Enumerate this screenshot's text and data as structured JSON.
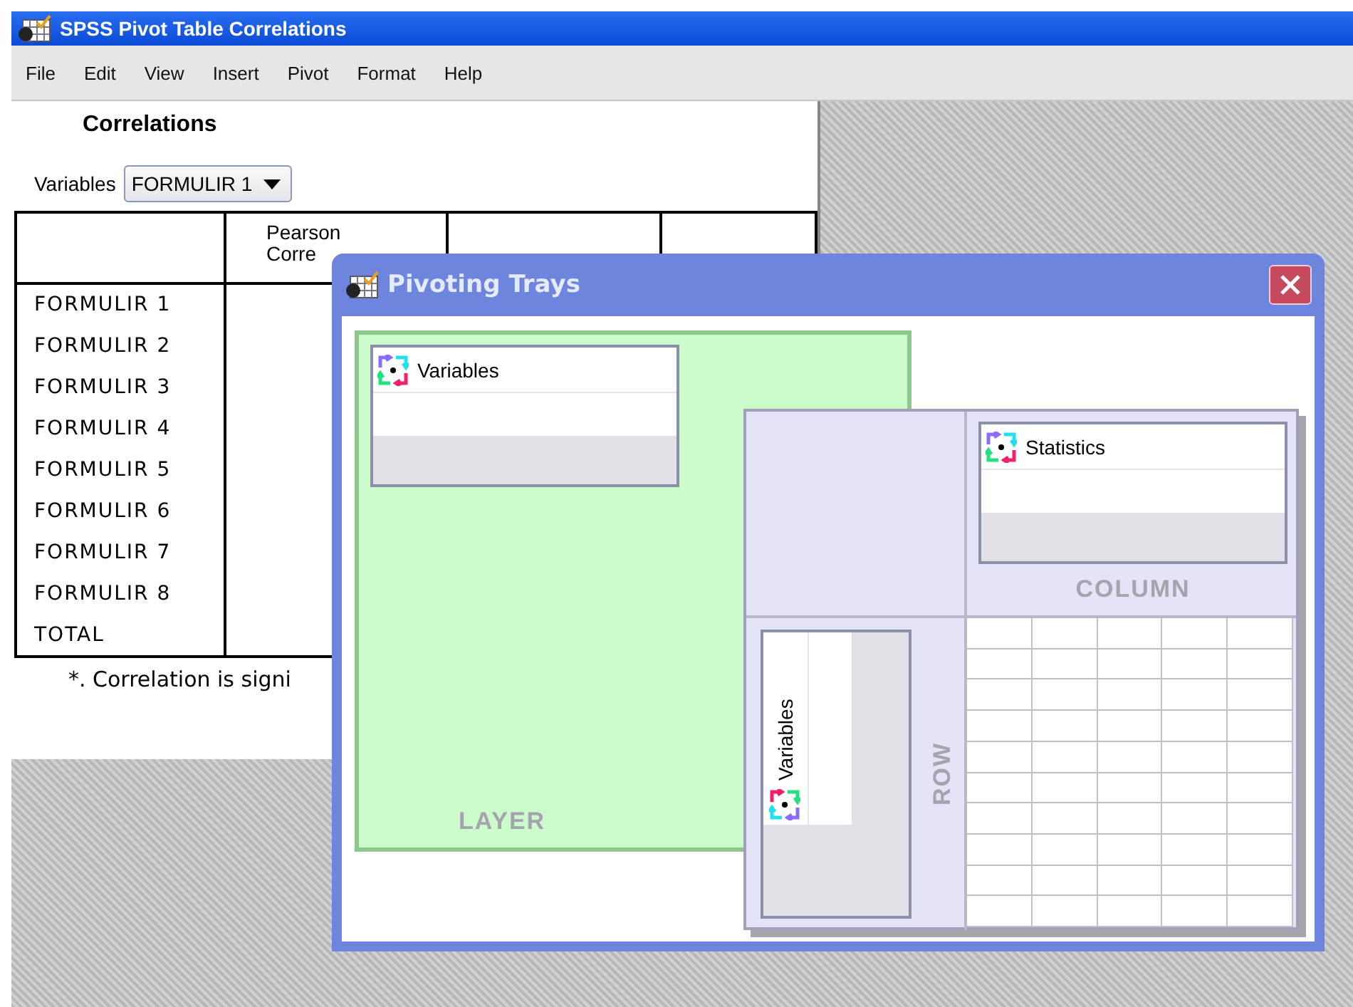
{
  "window": {
    "title": "SPSS Pivot Table Correlations"
  },
  "menu": [
    "File",
    "Edit",
    "View",
    "Insert",
    "Pivot",
    "Format",
    "Help"
  ],
  "report": {
    "title": "Correlations",
    "layer_label": "Variables",
    "layer_value": "FORMULIR 1",
    "header_cell": {
      "lines": [
        "Pearson",
        "Corre"
      ]
    },
    "rows": [
      "FORMULIR 1",
      "FORMULIR 2",
      "FORMULIR 3",
      "FORMULIR 4",
      "FORMULIR 5",
      "FORMULIR 6",
      "FORMULIR 7",
      "FORMULIR 8",
      "TOTAL"
    ],
    "footnote": "*. Correlation is signi"
  },
  "dialog": {
    "title": "Pivoting Trays",
    "layer": {
      "label": "LAYER",
      "items": [
        "Variables"
      ]
    },
    "column": {
      "label": "COLUMN",
      "items": [
        "Statistics"
      ]
    },
    "row": {
      "label": "ROW",
      "items": [
        "Variables"
      ]
    }
  }
}
